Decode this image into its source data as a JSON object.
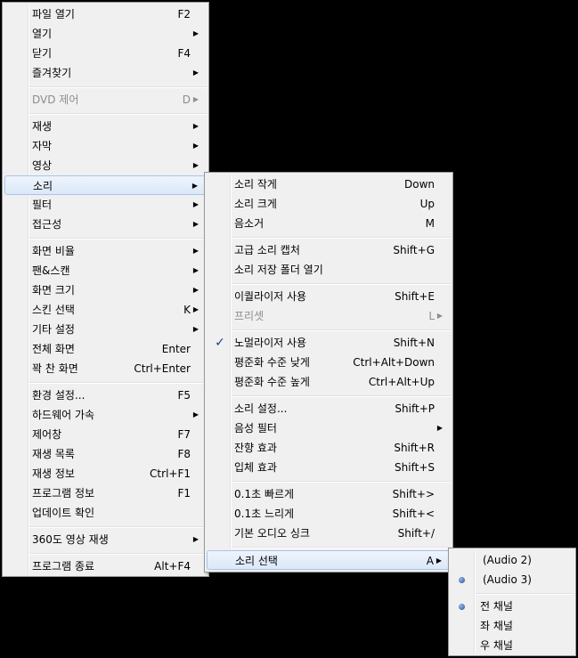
{
  "main_menu": {
    "items": [
      {
        "label": "파일 열기",
        "shortcut": "F2"
      },
      {
        "label": "열기",
        "arrow": "▶"
      },
      {
        "label": "닫기",
        "shortcut": "F4"
      },
      {
        "label": "즐겨찾기",
        "arrow": "▶"
      },
      {
        "label": "DVD 제어",
        "shortcut": "D",
        "arrow": "▶"
      },
      {
        "label": "재생",
        "arrow": "▶"
      },
      {
        "label": "자막",
        "arrow": "▶"
      },
      {
        "label": "영상",
        "arrow": "▶"
      },
      {
        "label": "소리",
        "arrow": "▶"
      },
      {
        "label": "필터",
        "arrow": "▶"
      },
      {
        "label": "접근성",
        "arrow": "▶"
      },
      {
        "label": "화면 비율",
        "arrow": "▶"
      },
      {
        "label": "팬&스캔",
        "arrow": "▶"
      },
      {
        "label": "화면 크기",
        "arrow": "▶"
      },
      {
        "label": "스킨 선택",
        "shortcut": "K",
        "arrow": "▶"
      },
      {
        "label": "기타 설정",
        "arrow": "▶"
      },
      {
        "label": "전체 화면",
        "shortcut": "Enter"
      },
      {
        "label": "꽉 찬 화면",
        "shortcut": "Ctrl+Enter"
      },
      {
        "label": "환경 설정...",
        "shortcut": "F5"
      },
      {
        "label": "하드웨어 가속",
        "arrow": "▶"
      },
      {
        "label": "제어창",
        "shortcut": "F7"
      },
      {
        "label": "재생 목록",
        "shortcut": "F8"
      },
      {
        "label": "재생 정보",
        "shortcut": "Ctrl+F1"
      },
      {
        "label": "프로그램 정보",
        "shortcut": "F1"
      },
      {
        "label": "업데이트 확인"
      },
      {
        "label": "360도 영상 재생",
        "arrow": "▶"
      },
      {
        "label": "프로그램 종료",
        "shortcut": "Alt+F4"
      }
    ]
  },
  "sound_menu": {
    "items": [
      {
        "label": "소리 작게",
        "shortcut": "Down"
      },
      {
        "label": "소리 크게",
        "shortcut": "Up"
      },
      {
        "label": "음소거",
        "shortcut": "M"
      },
      {
        "label": "고급 소리 캡처",
        "shortcut": "Shift+G"
      },
      {
        "label": "소리 저장 폴더 열기"
      },
      {
        "label": "이퀄라이저 사용",
        "shortcut": "Shift+E"
      },
      {
        "label": "프리셋",
        "shortcut": "L",
        "arrow": "▶"
      },
      {
        "label": "노멀라이저 사용",
        "shortcut": "Shift+N",
        "check": "✓"
      },
      {
        "label": "평준화 수준 낮게",
        "shortcut": "Ctrl+Alt+Down"
      },
      {
        "label": "평준화 수준 높게",
        "shortcut": "Ctrl+Alt+Up"
      },
      {
        "label": "소리 설정...",
        "shortcut": "Shift+P"
      },
      {
        "label": "음성 필터",
        "arrow": "▶"
      },
      {
        "label": "잔향 효과",
        "shortcut": "Shift+R"
      },
      {
        "label": "입체 효과",
        "shortcut": "Shift+S"
      },
      {
        "label": "0.1초 빠르게",
        "shortcut": "Shift+>"
      },
      {
        "label": "0.1초 느리게",
        "shortcut": "Shift+<"
      },
      {
        "label": "기본 오디오 싱크",
        "shortcut": "Shift+/"
      },
      {
        "label": "소리 선택",
        "shortcut": "A",
        "arrow": "▶"
      }
    ]
  },
  "audio_menu": {
    "items": [
      {
        "label": "(Audio 2)"
      },
      {
        "label": "(Audio 3)"
      },
      {
        "label": "전 채널"
      },
      {
        "label": "좌 채널"
      },
      {
        "label": "우 채널"
      }
    ]
  }
}
